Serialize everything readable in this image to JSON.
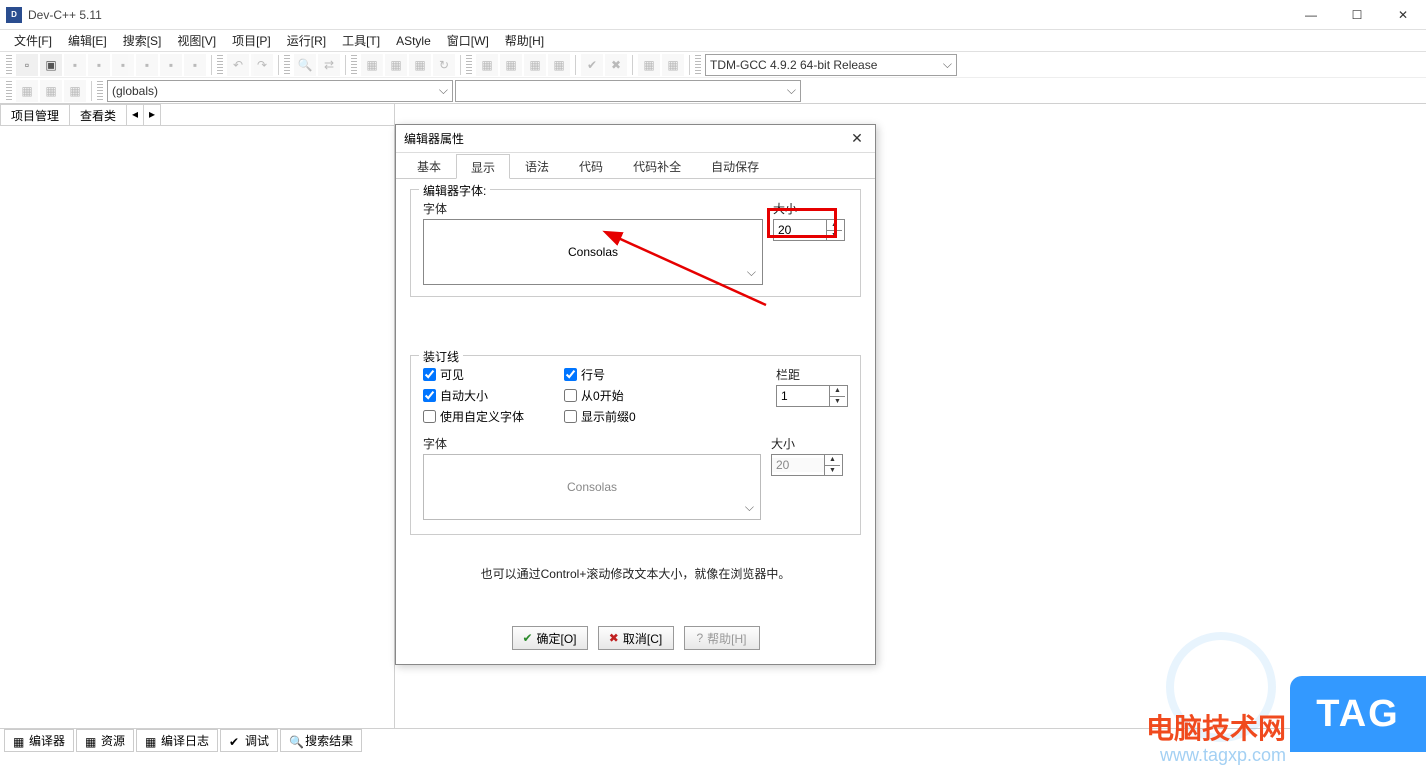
{
  "titlebar": {
    "title": "Dev-C++ 5.11"
  },
  "menu": [
    "文件[F]",
    "编辑[E]",
    "搜索[S]",
    "视图[V]",
    "项目[P]",
    "运行[R]",
    "工具[T]",
    "AStyle",
    "窗口[W]",
    "帮助[H]"
  ],
  "toolbar2": {
    "globals": "(globals)"
  },
  "compiler_combo": "TDM-GCC 4.9.2 64-bit Release",
  "left_tabs": {
    "t1": "项目管理",
    "t2": "查看类"
  },
  "dialog": {
    "title": "编辑器属性",
    "tabs": [
      "基本",
      "显示",
      "语法",
      "代码",
      "代码补全",
      "自动保存"
    ],
    "active_tab": 1,
    "editor_font": {
      "legend": "编辑器字体:",
      "font_label": "字体",
      "font_value": "Consolas",
      "size_label": "大小",
      "size_value": "20"
    },
    "gutter": {
      "legend": "装订线",
      "col1": {
        "c1": "可见",
        "c2": "自动大小",
        "c3": "使用自定义字体"
      },
      "col2": {
        "c1": "行号",
        "c2": "从0开始",
        "c3": "显示前缀0"
      },
      "spacing_label": "栏距",
      "spacing_value": "1",
      "font_label": "字体",
      "font_value": "Consolas",
      "size_label": "大小",
      "size_value": "20"
    },
    "hint": "也可以通过Control+滚动修改文本大小，就像在浏览器中。",
    "buttons": {
      "ok": "确定[O]",
      "cancel": "取消[C]",
      "help": "帮助[H]"
    }
  },
  "bottom_tabs": [
    "编译器",
    "资源",
    "编译日志",
    "调试",
    "搜索结果"
  ],
  "watermarks": {
    "name": "电脑技术网",
    "url": "www.tagxp.com",
    "tag": "TAG"
  }
}
